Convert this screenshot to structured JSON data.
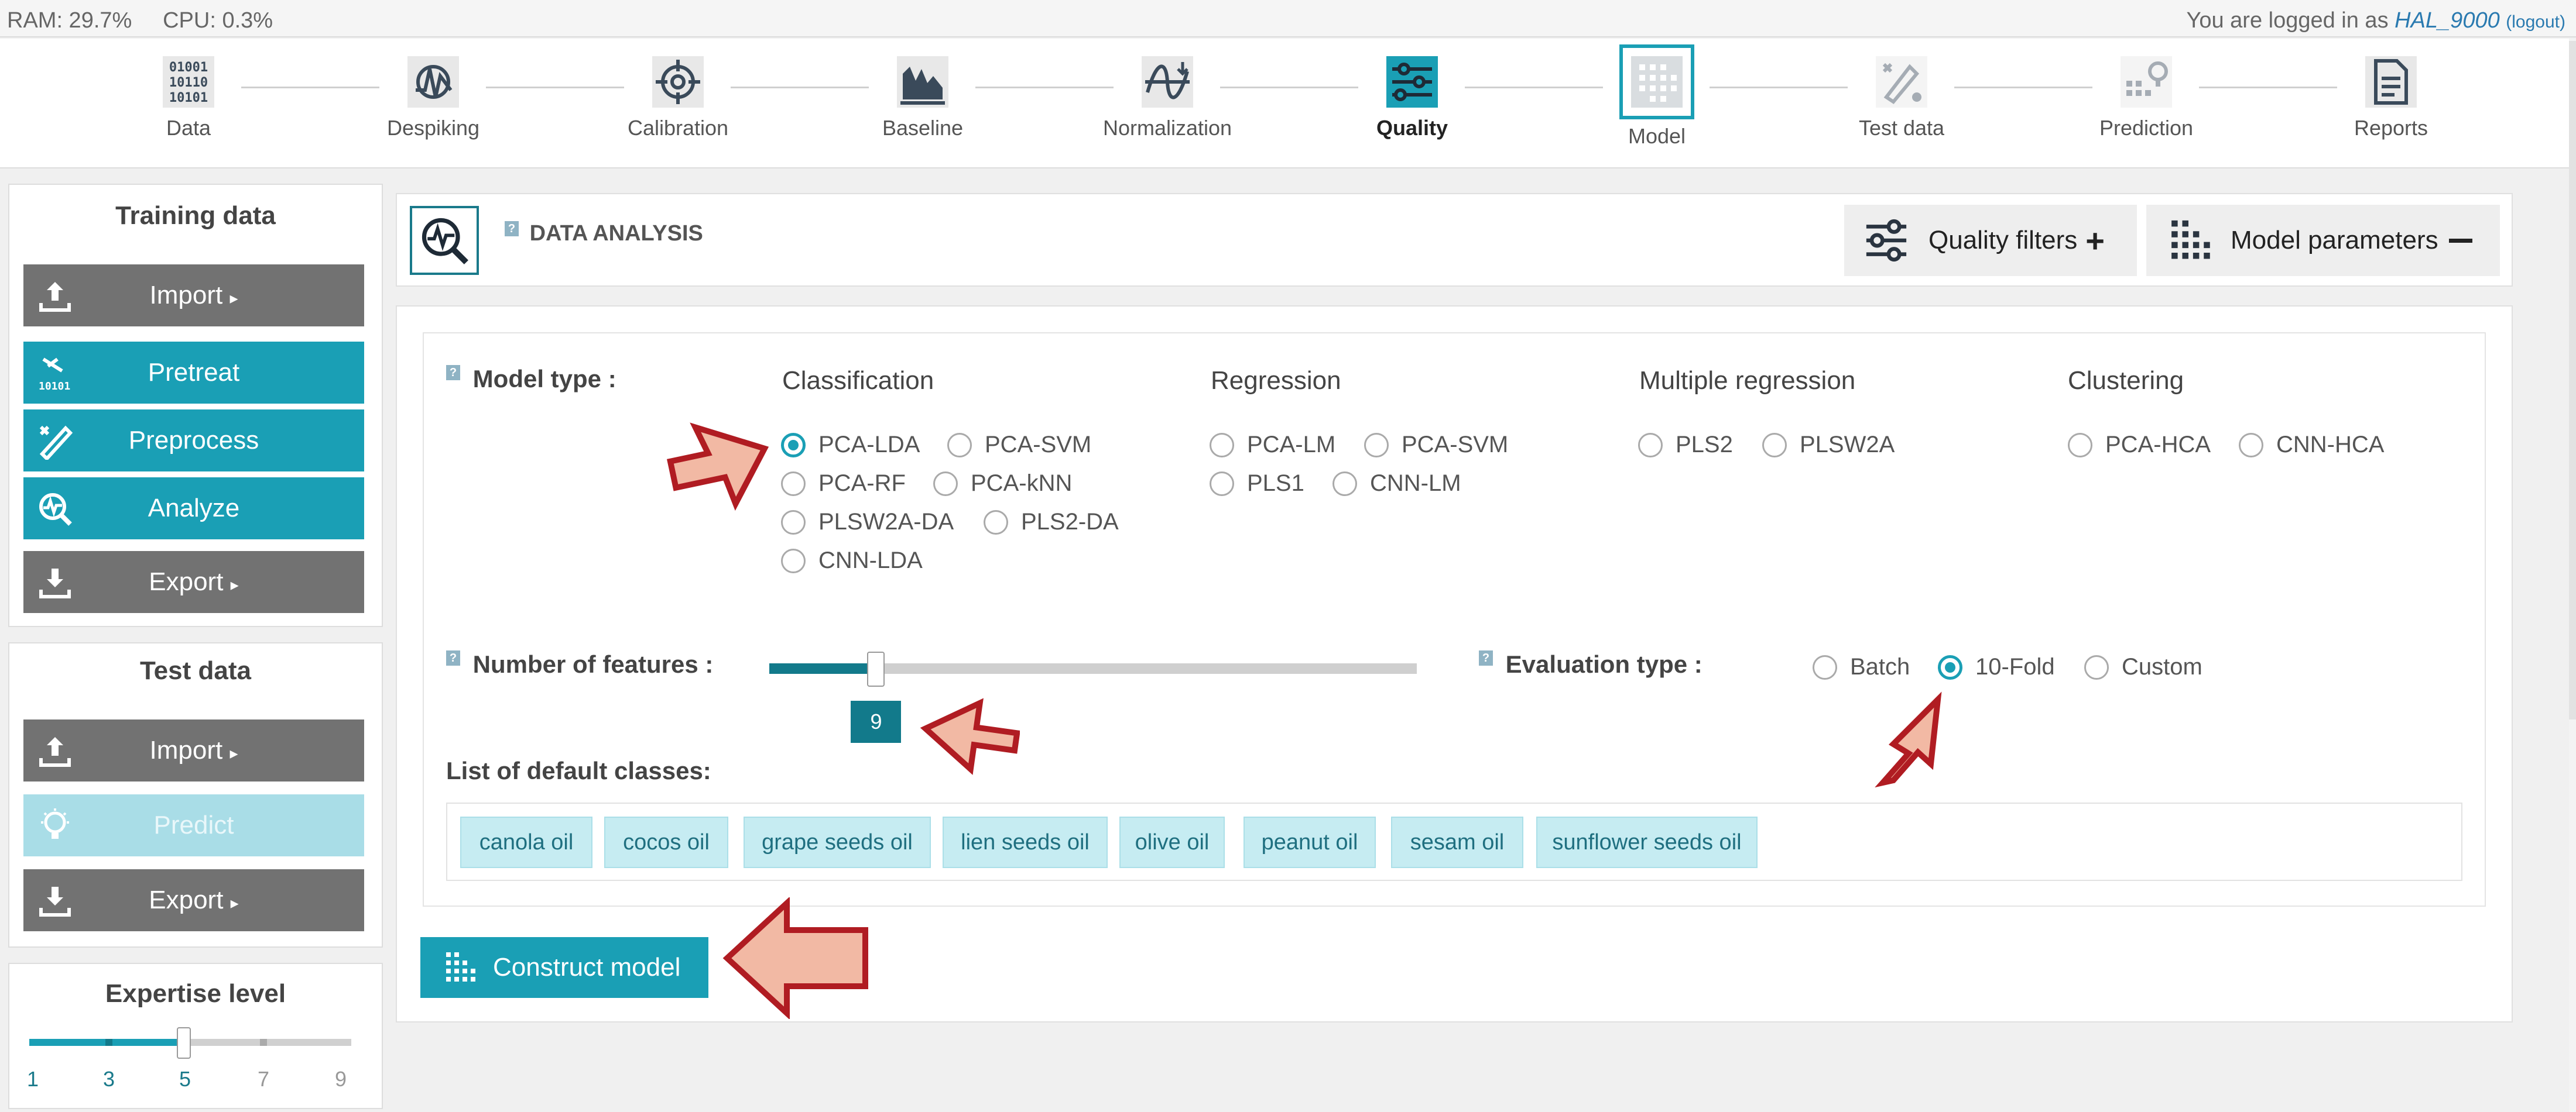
{
  "topbar": {
    "ram": "RAM: 29.7%",
    "cpu": "CPU: 0.3%",
    "login_prefix": "You are logged in as ",
    "user": "HAL_9000",
    "logout": "(logout)"
  },
  "steps": [
    {
      "label": "Data",
      "icon": "data-binary-icon"
    },
    {
      "label": "Despiking",
      "icon": "despiking-icon"
    },
    {
      "label": "Calibration",
      "icon": "target-icon"
    },
    {
      "label": "Baseline",
      "icon": "baseline-icon"
    },
    {
      "label": "Normalization",
      "icon": "normalization-icon"
    },
    {
      "label": "Quality",
      "icon": "sliders-icon"
    },
    {
      "label": "Model",
      "icon": "dots-grid-icon"
    },
    {
      "label": "Test data",
      "icon": "test-data-icon"
    },
    {
      "label": "Prediction",
      "icon": "prediction-icon"
    },
    {
      "label": "Reports",
      "icon": "report-icon"
    }
  ],
  "sidebar": {
    "training": {
      "title": "Training data",
      "import": "Import",
      "pretreat": "Pretreat",
      "preprocess": "Preprocess",
      "analyze": "Analyze",
      "export": "Export"
    },
    "test": {
      "title": "Test data",
      "import": "Import",
      "predict": "Predict",
      "export": "Export"
    },
    "expertise": {
      "title": "Expertise level",
      "ticks": [
        "1",
        "3",
        "5",
        "7",
        "9"
      ],
      "value": 5
    }
  },
  "header": {
    "badge": "?",
    "title": "DATA ANALYSIS",
    "quality_filters": "Quality filters",
    "model_parameters": "Model parameters"
  },
  "form": {
    "model_type_label": "Model type :",
    "columns": {
      "classification": {
        "title": "Classification",
        "options": [
          "PCA-LDA",
          "PCA-SVM",
          "PCA-RF",
          "PCA-kNN",
          "PLSW2A-DA",
          "PLS2-DA",
          "CNN-LDA"
        ]
      },
      "regression": {
        "title": "Regression",
        "options": [
          "PCA-LM",
          "PCA-SVM",
          "PLS1",
          "CNN-LM"
        ]
      },
      "multiple_regression": {
        "title": "Multiple regression",
        "options": [
          "PLS2",
          "PLSW2A"
        ]
      },
      "clustering": {
        "title": "Clustering",
        "options": [
          "PCA-HCA",
          "CNN-HCA"
        ]
      }
    },
    "selected_model": "PCA-LDA",
    "features_label": "Number of features :",
    "features_value": "9",
    "features_fraction": 0.165,
    "evaluation_label": "Evaluation type :",
    "evaluation_options": [
      "Batch",
      "10-Fold",
      "Custom"
    ],
    "evaluation_selected": "10-Fold",
    "classes_label": "List of default classes:",
    "classes": [
      "canola oil",
      "cocos oil",
      "grape seeds oil",
      "lien seeds oil",
      "olive oil",
      "peanut oil",
      "sesam oil",
      "sunflower seeds oil"
    ],
    "construct_button": "Construct model"
  },
  "colors": {
    "teal": "#1a9fb5",
    "grey_button": "#727272",
    "chip_bg": "#c6ecf2",
    "arrow_fill": "#f2b9a4",
    "arrow_stroke": "#b01c22"
  }
}
